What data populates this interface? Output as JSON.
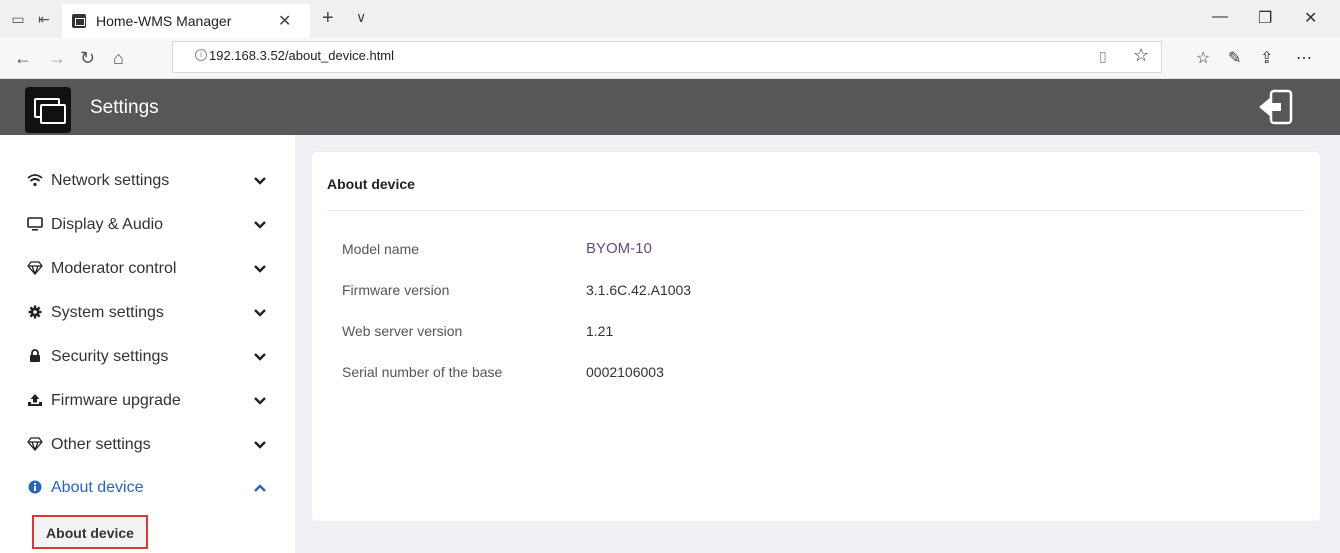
{
  "browser": {
    "tab_title": "Home-WMS Manager",
    "url": "192.168.3.52/about_device.html"
  },
  "header": {
    "title": "Settings",
    "bg_color": "#555759"
  },
  "sidebar": {
    "items": [
      {
        "label": "Network settings",
        "icon": "wifi-icon",
        "expanded": false
      },
      {
        "label": "Display & Audio",
        "icon": "monitor-icon",
        "expanded": false
      },
      {
        "label": "Moderator control",
        "icon": "diamond-icon",
        "expanded": false
      },
      {
        "label": "System settings",
        "icon": "gear-icon",
        "expanded": false
      },
      {
        "label": "Security settings",
        "icon": "lock-icon",
        "expanded": false
      },
      {
        "label": "Firmware upgrade",
        "icon": "upload-icon",
        "expanded": false
      },
      {
        "label": "Other settings",
        "icon": "diamond-icon",
        "expanded": false
      },
      {
        "label": "About device",
        "icon": "info-icon",
        "expanded": true
      }
    ],
    "sub_items": [
      {
        "label": "About device"
      }
    ],
    "active_color": "#2a65b8"
  },
  "main": {
    "card_title": "About device",
    "rows": [
      {
        "label": "Model name",
        "value": "BYOM-10"
      },
      {
        "label": "Firmware version",
        "value": "3.1.6C.42.A1003"
      },
      {
        "label": "Web server version",
        "value": "1.21"
      },
      {
        "label": "Serial number of the base",
        "value": "0002106003"
      }
    ]
  }
}
